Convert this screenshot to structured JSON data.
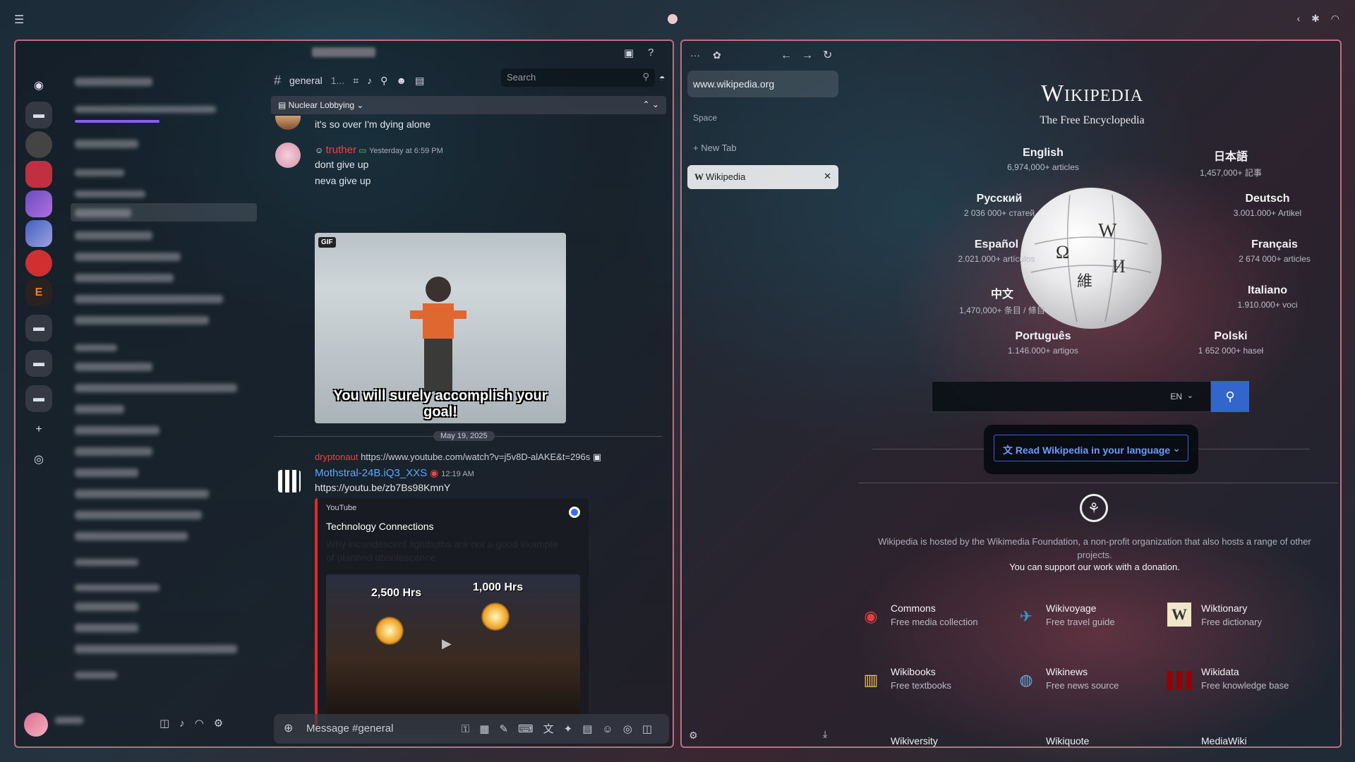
{
  "discord": {
    "channel_name": "general",
    "channel_count": "1...",
    "search_placeholder": "Search",
    "thread_name": "Nuclear Lobbying",
    "messages": [
      {
        "text": "it's so over I'm dying alone"
      },
      {
        "author": "truther",
        "time": "Yesterday at 6:59 PM",
        "lines": [
          "dont give up",
          "neva give up"
        ]
      }
    ],
    "gif_caption": "You will surely accomplish your goal!",
    "gif_tag": "GIF",
    "date_separator": "May 19, 2025",
    "reply": {
      "author": "dryptonaut",
      "text": "https://www.youtube.com/watch?v=j5v8D-alAKE&t=296s"
    },
    "bot_message": {
      "author": "Mothstral-24B.iQ3_XXS",
      "time": "12:19 AM",
      "link": "https://youtu.be/zb7Bs98KmnY"
    },
    "embed": {
      "provider": "YouTube",
      "channel": "Technology Connections",
      "title": "Why incandescent lightbulbs are not a good example of planned obsolescence",
      "label_left": "2,500 Hrs",
      "label_right": "1,000 Hrs"
    },
    "composer_placeholder": "Message #general"
  },
  "browser": {
    "url": "www.wikipedia.org",
    "space_label": "Space",
    "new_tab": "New Tab",
    "tab_title": "Wikipedia"
  },
  "wikipedia": {
    "wordmark": "Wikipedia",
    "tagline": "The Free Encyclopedia",
    "languages": [
      {
        "name": "English",
        "count": "6,974,000+ articles"
      },
      {
        "name": "日本語",
        "count": "1,457,000+ 記事"
      },
      {
        "name": "Русский",
        "count": "2 036 000+ статей"
      },
      {
        "name": "Deutsch",
        "count": "3.001.000+ Artikel"
      },
      {
        "name": "Español",
        "count": "2.021.000+ artículos"
      },
      {
        "name": "Français",
        "count": "2 674 000+ articles"
      },
      {
        "name": "中文",
        "count": "1,470,000+ 条目 / 條目"
      },
      {
        "name": "Italiano",
        "count": "1.910.000+ voci"
      },
      {
        "name": "Português",
        "count": "1.146.000+ artigos"
      },
      {
        "name": "Polski",
        "count": "1 652 000+ haseł"
      }
    ],
    "search_lang": "EN",
    "read_button": "Read Wikipedia in your language",
    "footer_text": "Wikipedia is hosted by the Wikimedia Foundation, a non-profit organization that also hosts a range of other projects.",
    "support_text": "You can support our work with a donation.",
    "projects": [
      {
        "name": "Commons",
        "desc": "Free media collection",
        "icon": "commons-icon",
        "color": "#e04040"
      },
      {
        "name": "Wikivoyage",
        "desc": "Free travel guide",
        "icon": "wikivoyage-icon",
        "color": "#3399cc"
      },
      {
        "name": "Wiktionary",
        "desc": "Free dictionary",
        "icon": "wiktionary-icon",
        "color": "#f0e6c8"
      },
      {
        "name": "Wikibooks",
        "desc": "Free textbooks",
        "icon": "wikibooks-icon",
        "color": "#f0c040"
      },
      {
        "name": "Wikinews",
        "desc": "Free news source",
        "icon": "wikinews-icon",
        "color": "#66aadd"
      },
      {
        "name": "Wikidata",
        "desc": "Free knowledge base",
        "icon": "wikidata-icon",
        "color": "#990000"
      },
      {
        "name": "Wikiversity",
        "desc": "",
        "icon": "wikiversity-icon",
        "color": "#3366cc"
      },
      {
        "name": "Wikiquote",
        "desc": "",
        "icon": "wikiquote-icon",
        "color": "#666666"
      },
      {
        "name": "MediaWiki",
        "desc": "",
        "icon": "mediawiki-icon",
        "color": "#cc6633"
      }
    ]
  },
  "colors": {
    "accent": "#3366cc",
    "window_border": "#e68296",
    "youtube_red": "#e02828",
    "link": "#00a8fc",
    "truther": "#f23f42"
  }
}
